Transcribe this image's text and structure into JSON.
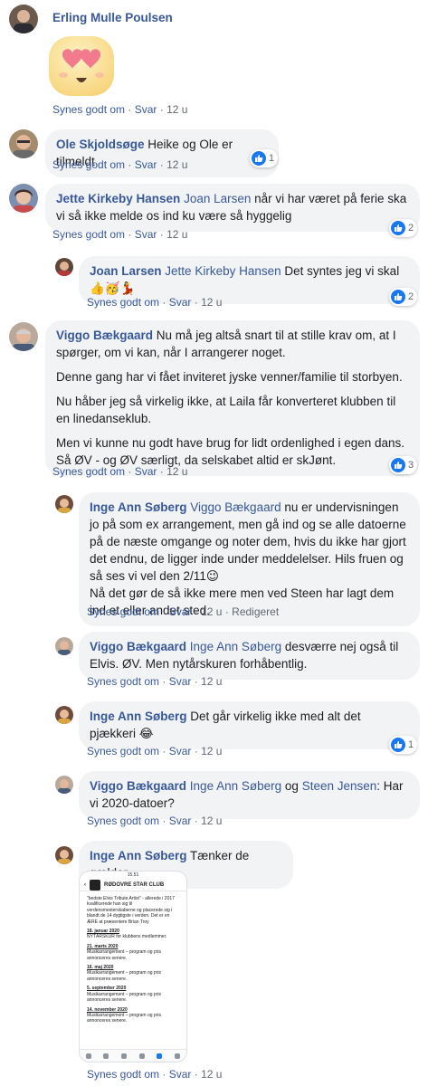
{
  "actions": {
    "like": "Synes godt om",
    "reply": "Svar",
    "sep": "·",
    "edited": "Redigeret"
  },
  "comments": [
    {
      "author": "Erling Mulle Poulsen",
      "time": "12 u",
      "sticker": "heart-eyes-emoji"
    },
    {
      "author": "Ole Skjoldsøge",
      "text": "Heike og Ole er tilmeldt",
      "time": "12 u",
      "reactions": "1"
    },
    {
      "author": "Jette Kirkeby Hansen",
      "mention": "Joan Larsen",
      "text": "når vi har været på ferie ska vi så ikke melde os ind ku være så hyggelig",
      "time": "12 u",
      "reactions": "2"
    },
    {
      "author": "Joan Larsen",
      "mention": "Jette Kirkeby Hansen",
      "text": "Det syntes jeg vi skal",
      "emoji": "👍🥳💃",
      "time": "12 u",
      "reactions": "2"
    },
    {
      "author": "Viggo Bækgaard",
      "paragraphs": [
        "Nu må jeg altså snart til at stille krav om, at I spørger, om vi kan, når I arrangerer noget.",
        "Denne gang har vi fået inviteret jyske venner/familie til storbyen.",
        "Nu håber jeg så virkelig ikke, at Laila får konverteret klubben til en linedanseklub.",
        "Men vi kunne nu godt have brug for lidt ordenlighed i egen dans. Så ØV - og ØV særligt, da selskabet altid er skJønt."
      ],
      "time": "12 u",
      "reactions": "3"
    },
    {
      "author": "Inge Ann Søberg",
      "mention": "Viggo Bækgaard",
      "text": "nu er undervisningen jo på som ex arrangement, men gå ind og se alle datoerne på de næste omgange og noter dem, hvis du ikke har gjort det endnu, de ligger inde under meddelelser. Hils fruen og så ses vi vel den 2/11😉",
      "text2": "Nå det gør de så ikke mere men ved Steen har lagt dem ind et eller andet sted.",
      "time": "12 u"
    },
    {
      "author": "Viggo Bækgaard",
      "mention": "Inge Ann Søberg",
      "text": "desværre nej også til Elvis. ØV. Men nytårskuren forhåbentlig.",
      "time": "12 u"
    },
    {
      "author": "Inge Ann Søberg",
      "text": "Det går virkelig ikke med alt det pjækkeri 😂",
      "time": "12 u",
      "reactions": "1"
    },
    {
      "author": "Viggo Bækgaard",
      "mention": "Inge Ann Søberg",
      "joiner": "og",
      "mention2": "Steen Jensen",
      "text": ": Har vi 2020-datoer?",
      "time": "12 u"
    },
    {
      "author": "Inge Ann Søberg",
      "text": "Tænker de gælder",
      "time": "12 u",
      "attachment": {
        "status_time": "15.51",
        "club": "RØDOVRE STAR CLUB",
        "intro": "\"bedste Elvis Tribute Artist\" - allerede i 2017 kvalificerede han sig til verdensmesterskaberne og placerede sig i blandt de 14 dygtigste i verden. Det er en ÆRE at præsentere Brian Troy",
        "events": [
          {
            "date": "18. januar 2020",
            "desc": "NYTÅRSKUR for klubbens medlemmer."
          },
          {
            "date": "21. marts 2020",
            "desc": "Musikarrangement – program og pris annonceres senere."
          },
          {
            "date": "16. maj 2020",
            "desc": "Musikarrangement – program og pris annonceres senere."
          },
          {
            "date": "5. september 2020",
            "desc": "Musikarrangement – program og pris annonceres senere."
          },
          {
            "date": "14. november 2020",
            "desc": "Musikarrangement – program og pris annonceres senere."
          }
        ]
      }
    }
  ],
  "colors": {
    "link": "#385898",
    "bubble": "#f2f3f5",
    "like": "#1877f2",
    "meta": "#606770"
  }
}
